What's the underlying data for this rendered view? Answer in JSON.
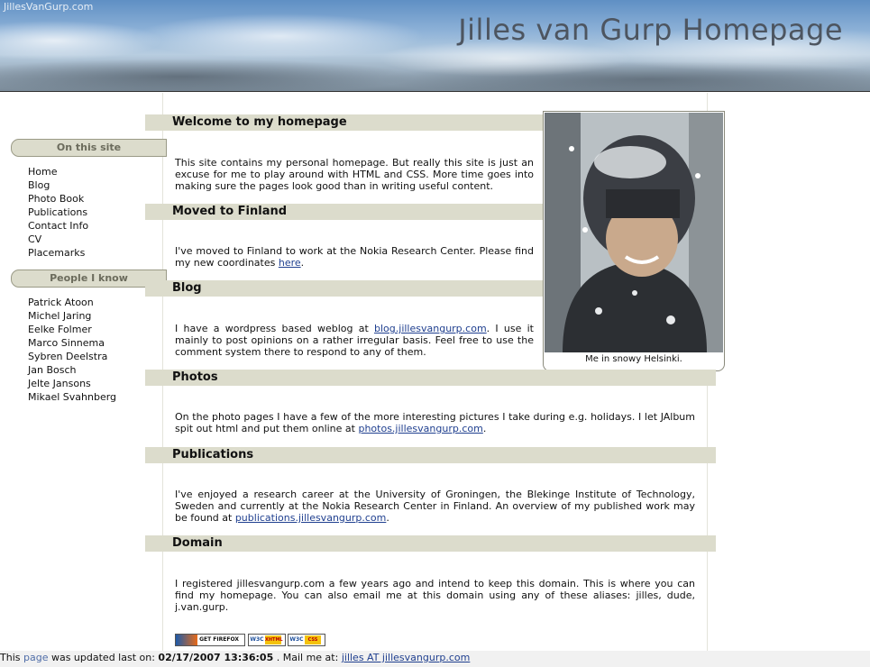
{
  "header": {
    "site_tag": "JillesVanGurp.com",
    "title": "Jilles van Gurp Homepage"
  },
  "sidebar": {
    "site_heading": "On this site",
    "site_links": [
      "Home",
      "Blog",
      "Photo Book",
      "Publications",
      "Contact Info",
      "CV",
      "Placemarks"
    ],
    "people_heading": "People I know",
    "people_links": [
      "Patrick Atoon",
      "Michel Jaring",
      "Eelke Folmer",
      "Marco Sinnema",
      "Sybren Deelstra",
      "Jan Bosch",
      "Jelte Jansons",
      "Mikael Svahnberg"
    ]
  },
  "photo": {
    "caption": "Me in snowy Helsinki."
  },
  "sections": {
    "welcome": {
      "title": "Welcome to my homepage",
      "text": "This site contains my personal homepage. But really this site is just an excuse for me to play around with HTML and CSS. More time goes into making sure the pages look good than in writing useful content."
    },
    "finland": {
      "title": "Moved to Finland",
      "text_before": "I've moved to Finland to work at the Nokia Research Center. Please find my new coordinates ",
      "link": "here",
      "text_after": "."
    },
    "blog": {
      "title": "Blog",
      "text_before": "I have a wordpress based weblog at ",
      "link": "blog.jillesvangurp.com",
      "text_after": ". I use it mainly to post opinions on a rather irregular basis. Feel free to use the comment system there to respond to any of them."
    },
    "photos": {
      "title": "Photos",
      "text_before": "On the photo pages I have a few of the more interesting pictures I take during e.g. holidays. I let JAlbum spit out html and put them online at ",
      "link": "photos.jillesvangurp.com",
      "text_after": "."
    },
    "publications": {
      "title": "Publications",
      "text_before": "I've enjoyed a research career at the University of Groningen, the Blekinge Institute of Technology, Sweden and currently at the Nokia Research Center in Finland. An overview of my published work may be found at ",
      "link": "publications.jillesvangurp.com",
      "text_after": "."
    },
    "domain": {
      "title": "Domain",
      "text": "I registered jillesvangurp.com a few years ago and intend to keep this domain. This is where you can find my homepage. You can also email me at this domain using any of these aliases: jilles, dude, j.van.gurp."
    }
  },
  "badges": {
    "firefox": "GET FIREFOX",
    "w3c": "W3C",
    "xhtml": "XHTML 1.0",
    "css": "CSS"
  },
  "footer": {
    "prefix": "This ",
    "page_link": "page",
    "middle": " was updated last on: ",
    "date": "02/17/2007 13:36:05",
    "mail_prefix": " . Mail me at: ",
    "mail_link": "jilles AT jillesvangurp.com"
  }
}
